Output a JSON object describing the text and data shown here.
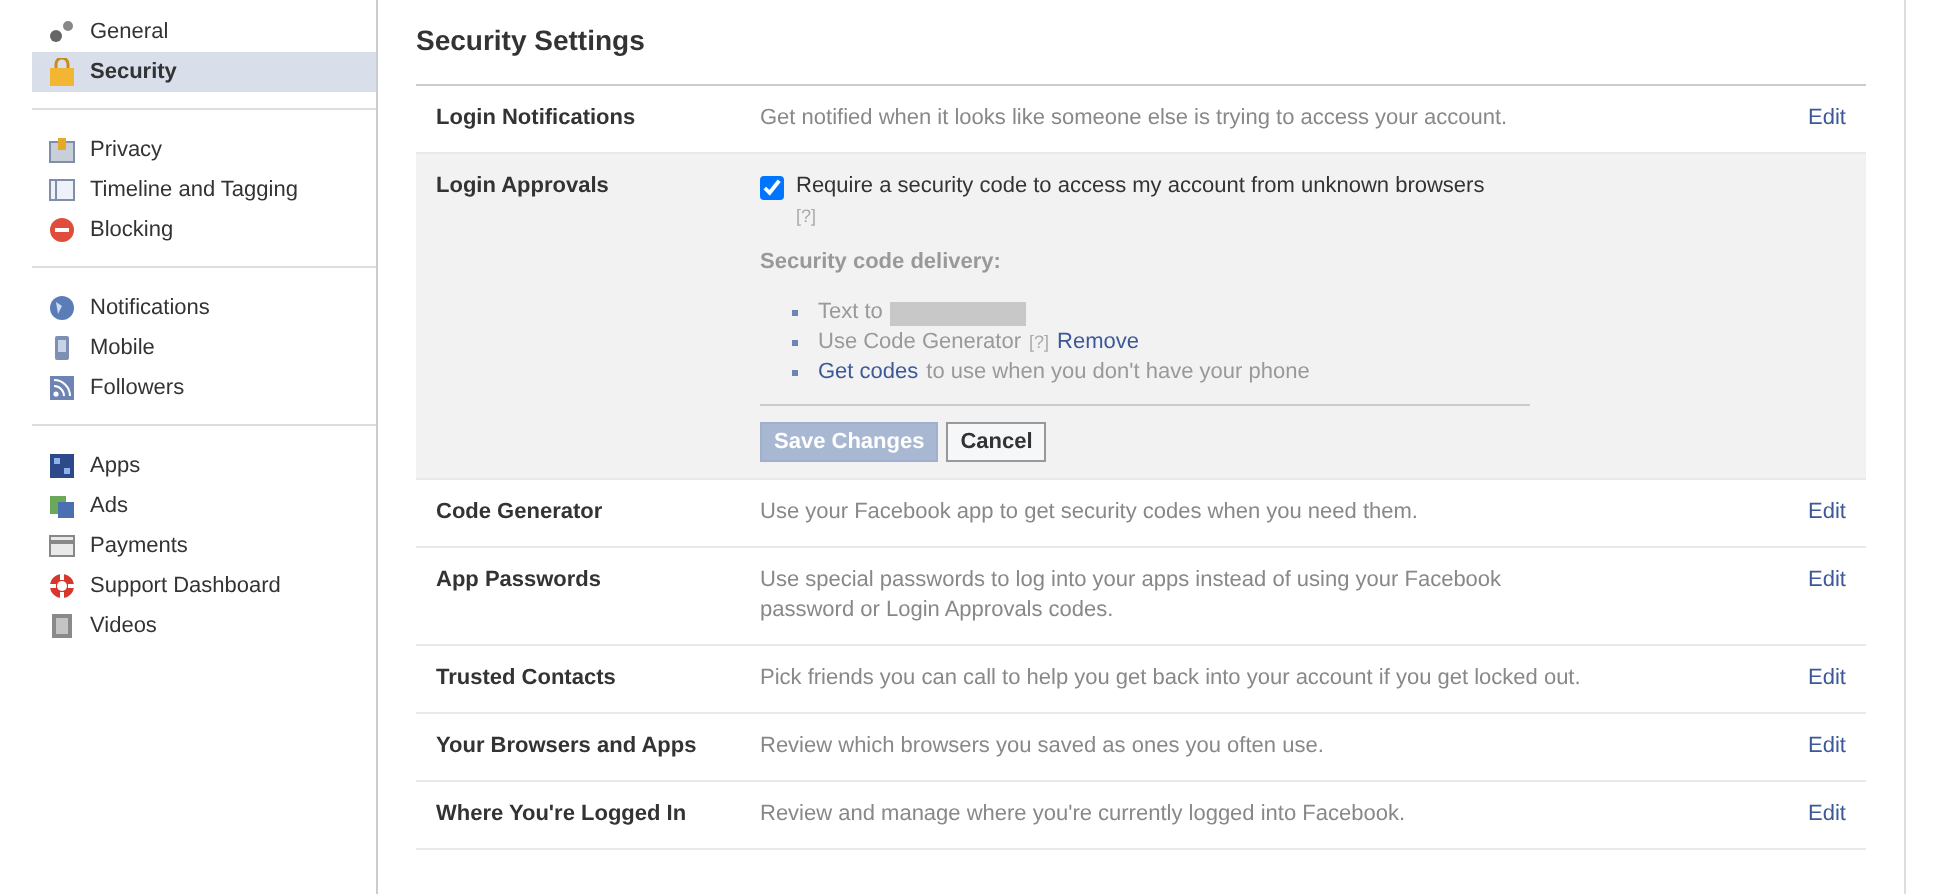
{
  "sidebar": {
    "groups": [
      {
        "items": [
          {
            "label": "General",
            "selected": false
          },
          {
            "label": "Security",
            "selected": true
          }
        ]
      },
      {
        "items": [
          {
            "label": "Privacy",
            "selected": false
          },
          {
            "label": "Timeline and Tagging",
            "selected": false
          },
          {
            "label": "Blocking",
            "selected": false
          }
        ]
      },
      {
        "items": [
          {
            "label": "Notifications",
            "selected": false
          },
          {
            "label": "Mobile",
            "selected": false
          },
          {
            "label": "Followers",
            "selected": false
          }
        ]
      },
      {
        "items": [
          {
            "label": "Apps",
            "selected": false
          },
          {
            "label": "Ads",
            "selected": false
          },
          {
            "label": "Payments",
            "selected": false
          },
          {
            "label": "Support Dashboard",
            "selected": false
          },
          {
            "label": "Videos",
            "selected": false
          }
        ]
      }
    ]
  },
  "page_title": "Security Settings",
  "rows": [
    {
      "kind": "collapsed",
      "label": "Login Notifications",
      "description": "Get notified when it looks like someone else is trying to access your account.",
      "action": "Edit"
    },
    {
      "kind": "expanded",
      "label": "Login Approvals",
      "checkbox": {
        "label": "Require a security code to access my account from unknown browsers",
        "checked": true,
        "help": "[?]"
      },
      "delivery_heading": "Security code delivery:",
      "delivery": [
        {
          "kind": "redacted",
          "text": "Text to"
        },
        {
          "kind": "generator",
          "text": "Use Code Generator",
          "help": "[?]",
          "link": "Remove"
        },
        {
          "kind": "codes",
          "link": "Get codes",
          "text": "to use when you don't have your phone"
        }
      ],
      "buttons": [
        {
          "label": "Save Changes",
          "kind": "primary",
          "disabled": true
        },
        {
          "label": "Cancel",
          "kind": "secondary",
          "disabled": false
        }
      ]
    },
    {
      "kind": "collapsed",
      "label": "Code Generator",
      "description": "Use your Facebook app to get security codes when you need them.",
      "action": "Edit"
    },
    {
      "kind": "collapsed",
      "label": "App Passwords",
      "description": "Use special passwords to log into your apps instead of using your Facebook password or Login Approvals codes.",
      "action": "Edit"
    },
    {
      "kind": "collapsed",
      "label": "Trusted Contacts",
      "description": "Pick friends you can call to help you get back into your account if you get locked out.",
      "action": "Edit"
    },
    {
      "kind": "collapsed",
      "label": "Your Browsers and Apps",
      "description": "Review which browsers you saved as ones you often use.",
      "action": "Edit"
    },
    {
      "kind": "collapsed",
      "label": "Where You're Logged In",
      "description": "Review and manage where you're currently logged into Facebook.",
      "action": "Edit"
    }
  ]
}
